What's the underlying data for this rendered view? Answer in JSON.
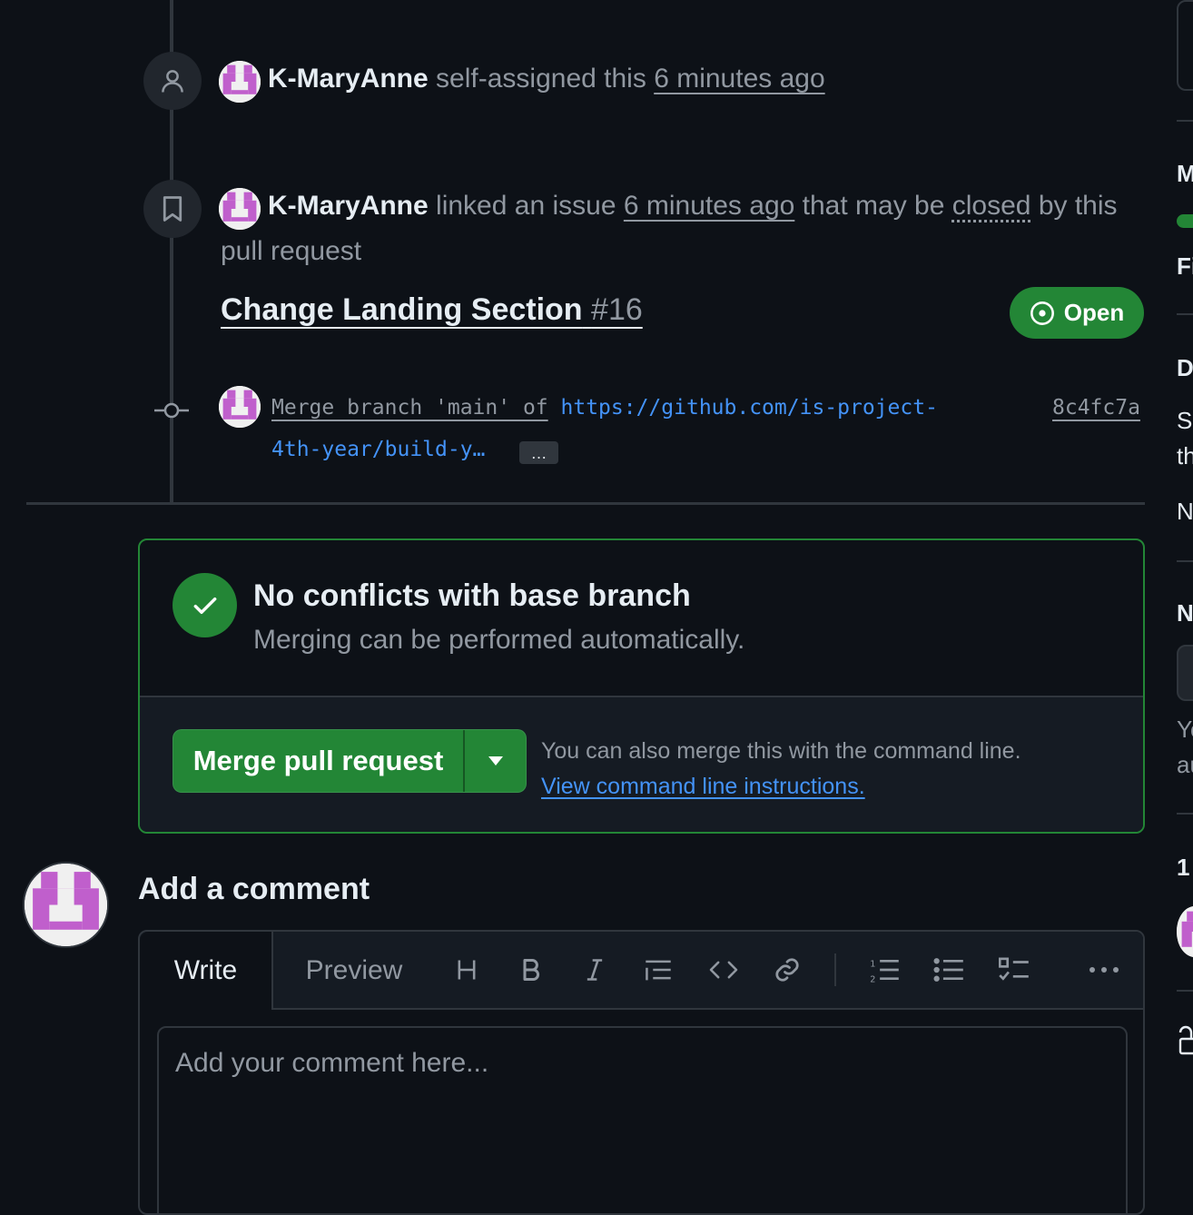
{
  "timeline": {
    "event1": {
      "user": "K-MaryAnne",
      "action": "self-assigned this",
      "time": "6 minutes ago",
      "icon": "person-icon"
    },
    "event2": {
      "user": "K-MaryAnne",
      "action": "linked an issue",
      "time": "6 minutes ago",
      "middle": "that may be",
      "closed": "closed",
      "tail": "by this",
      "tail2": "pull request",
      "icon": "bookmark-icon"
    },
    "linked_issue": {
      "title": "Change Landing Section",
      "number": "#16",
      "status": "Open"
    },
    "commit": {
      "message": "Merge branch 'main' of",
      "link_line1": "https://github.com/is-project-",
      "link_line2": "4th-year/build-y…",
      "more": "…",
      "sha": "8c4fc7a"
    }
  },
  "merge": {
    "title": "No conflicts with base branch",
    "subtitle": "Merging can be performed automatically.",
    "button_label": "Merge pull request",
    "help_text": "You can also merge this with the command line.",
    "help_link": "View command line instructions."
  },
  "comment": {
    "title": "Add a comment",
    "tab_write": "Write",
    "tab_preview": "Preview",
    "placeholder": "Add your comment here..."
  },
  "sidebar_fragments": {
    "m": "M",
    "fi": "Fi",
    "d": "D",
    "s": "S",
    "th": "th",
    "n1": "N",
    "n2": "N",
    "yo": "Yo",
    "au": "au",
    "one": "1"
  },
  "colors": {
    "background": "#0d1117",
    "accent_green": "#238636",
    "link_blue": "#4493f8",
    "muted": "#9198a1",
    "border": "#30363d"
  }
}
